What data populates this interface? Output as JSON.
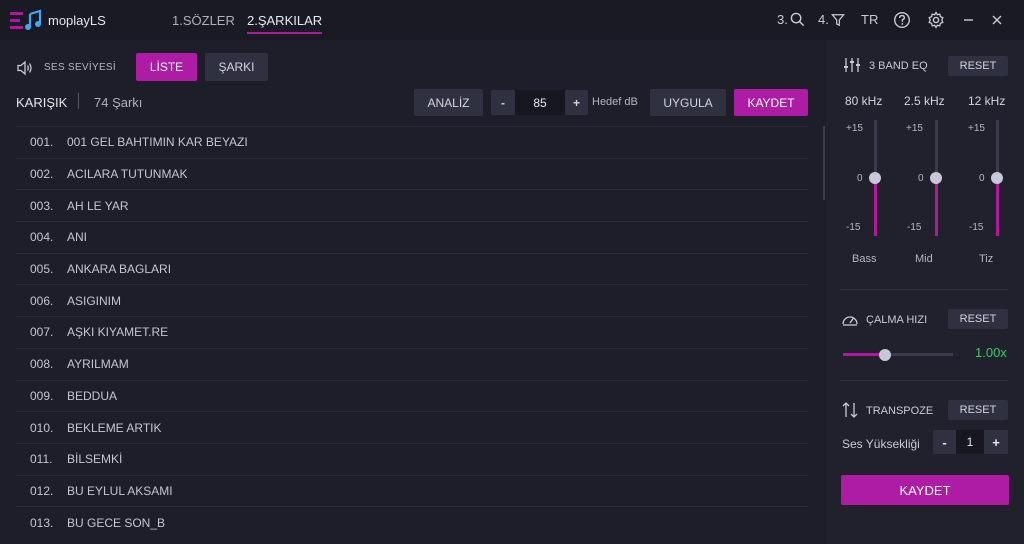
{
  "app": {
    "title": "moplayLS"
  },
  "nav": {
    "tabs": [
      {
        "label": "1.SÖZLER"
      },
      {
        "label": "2.ŞARKILAR"
      }
    ]
  },
  "toolbar": {
    "search_label": "3.",
    "filter_label": "4.",
    "language": "TR"
  },
  "panel": {
    "volume_label": "SES SEVİYESİ",
    "mode_buttons": [
      {
        "label": "LİSTE"
      },
      {
        "label": "ŞARKI"
      }
    ],
    "playlist_name": "KARIŞIK",
    "track_count": "74 Şarkı",
    "analyze_label": "ANALİZ",
    "minus_label": "-",
    "db_value": "85",
    "plus_label": "+",
    "target_label": "Hedef dB",
    "apply_label": "UYGULA",
    "save_label": "KAYDET"
  },
  "songs": [
    {
      "num": "001.",
      "title": "001 GEL BAHTIMIN KAR BEYAZI"
    },
    {
      "num": "002.",
      "title": "ACILARA TUTUNMAK"
    },
    {
      "num": "003.",
      "title": "AH LE YAR"
    },
    {
      "num": "004.",
      "title": "ANI"
    },
    {
      "num": "005.",
      "title": "ANKARA BAGLARI"
    },
    {
      "num": "006.",
      "title": "ASIGINIM"
    },
    {
      "num": "007.",
      "title": "AŞKI KIYAMET.RE"
    },
    {
      "num": "008.",
      "title": "AYRILMAM"
    },
    {
      "num": "009.",
      "title": "BEDDUA"
    },
    {
      "num": "010.",
      "title": "BEKLEME ARTIK"
    },
    {
      "num": "011.",
      "title": "BİLSEMKİ"
    },
    {
      "num": "012.",
      "title": "BU EYLUL AKSAMI"
    },
    {
      "num": "013.",
      "title": "BU GECE SON_B"
    }
  ],
  "eq": {
    "title": "3 BAND EQ",
    "reset_label": "RESET",
    "ticks": {
      "top": "+15",
      "mid": "0",
      "bottom": "-15"
    },
    "bands": [
      {
        "freq": "80 kHz",
        "name": "Bass",
        "value_db": 0
      },
      {
        "freq": "2.5 kHz",
        "name": "Mid",
        "value_db": 0
      },
      {
        "freq": "12 kHz",
        "name": "Tiz",
        "value_db": 0
      }
    ]
  },
  "speed": {
    "title": "ÇALMA HIZI",
    "reset_label": "RESET",
    "value": "1.00x",
    "slider_fraction": 0.38
  },
  "transpose": {
    "title": "TRANSPOZE",
    "reset_label": "RESET",
    "pitch_label": "Ses Yüksekliği",
    "minus_label": "-",
    "value": "1",
    "plus_label": "+"
  },
  "footer": {
    "save_label": "KAYDET"
  },
  "colors": {
    "accent": "#b4179f",
    "speed_value": "#2fd05d",
    "background": "#1b1c27"
  },
  "icons": [
    "app-logo-icon",
    "search-icon",
    "filter-icon",
    "help-icon",
    "gear-icon",
    "minimize-icon",
    "close-icon",
    "speaker-icon",
    "sliders-icon",
    "speedometer-icon",
    "transpose-arrows-icon"
  ]
}
